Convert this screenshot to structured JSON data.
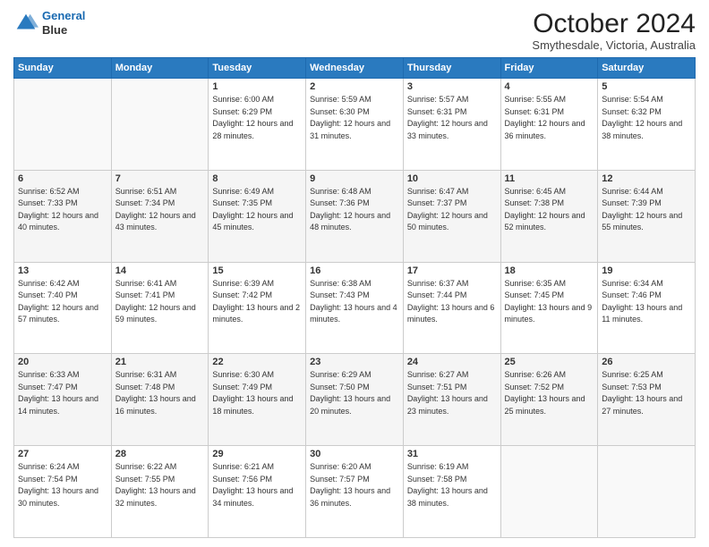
{
  "logo": {
    "line1": "General",
    "line2": "Blue"
  },
  "title": "October 2024",
  "subtitle": "Smythesdale, Victoria, Australia",
  "days_of_week": [
    "Sunday",
    "Monday",
    "Tuesday",
    "Wednesday",
    "Thursday",
    "Friday",
    "Saturday"
  ],
  "weeks": [
    [
      {
        "day": "",
        "sunrise": "",
        "sunset": "",
        "daylight": ""
      },
      {
        "day": "",
        "sunrise": "",
        "sunset": "",
        "daylight": ""
      },
      {
        "day": "1",
        "sunrise": "Sunrise: 6:00 AM",
        "sunset": "Sunset: 6:29 PM",
        "daylight": "Daylight: 12 hours and 28 minutes."
      },
      {
        "day": "2",
        "sunrise": "Sunrise: 5:59 AM",
        "sunset": "Sunset: 6:30 PM",
        "daylight": "Daylight: 12 hours and 31 minutes."
      },
      {
        "day": "3",
        "sunrise": "Sunrise: 5:57 AM",
        "sunset": "Sunset: 6:31 PM",
        "daylight": "Daylight: 12 hours and 33 minutes."
      },
      {
        "day": "4",
        "sunrise": "Sunrise: 5:55 AM",
        "sunset": "Sunset: 6:31 PM",
        "daylight": "Daylight: 12 hours and 36 minutes."
      },
      {
        "day": "5",
        "sunrise": "Sunrise: 5:54 AM",
        "sunset": "Sunset: 6:32 PM",
        "daylight": "Daylight: 12 hours and 38 minutes."
      }
    ],
    [
      {
        "day": "6",
        "sunrise": "Sunrise: 6:52 AM",
        "sunset": "Sunset: 7:33 PM",
        "daylight": "Daylight: 12 hours and 40 minutes."
      },
      {
        "day": "7",
        "sunrise": "Sunrise: 6:51 AM",
        "sunset": "Sunset: 7:34 PM",
        "daylight": "Daylight: 12 hours and 43 minutes."
      },
      {
        "day": "8",
        "sunrise": "Sunrise: 6:49 AM",
        "sunset": "Sunset: 7:35 PM",
        "daylight": "Daylight: 12 hours and 45 minutes."
      },
      {
        "day": "9",
        "sunrise": "Sunrise: 6:48 AM",
        "sunset": "Sunset: 7:36 PM",
        "daylight": "Daylight: 12 hours and 48 minutes."
      },
      {
        "day": "10",
        "sunrise": "Sunrise: 6:47 AM",
        "sunset": "Sunset: 7:37 PM",
        "daylight": "Daylight: 12 hours and 50 minutes."
      },
      {
        "day": "11",
        "sunrise": "Sunrise: 6:45 AM",
        "sunset": "Sunset: 7:38 PM",
        "daylight": "Daylight: 12 hours and 52 minutes."
      },
      {
        "day": "12",
        "sunrise": "Sunrise: 6:44 AM",
        "sunset": "Sunset: 7:39 PM",
        "daylight": "Daylight: 12 hours and 55 minutes."
      }
    ],
    [
      {
        "day": "13",
        "sunrise": "Sunrise: 6:42 AM",
        "sunset": "Sunset: 7:40 PM",
        "daylight": "Daylight: 12 hours and 57 minutes."
      },
      {
        "day": "14",
        "sunrise": "Sunrise: 6:41 AM",
        "sunset": "Sunset: 7:41 PM",
        "daylight": "Daylight: 12 hours and 59 minutes."
      },
      {
        "day": "15",
        "sunrise": "Sunrise: 6:39 AM",
        "sunset": "Sunset: 7:42 PM",
        "daylight": "Daylight: 13 hours and 2 minutes."
      },
      {
        "day": "16",
        "sunrise": "Sunrise: 6:38 AM",
        "sunset": "Sunset: 7:43 PM",
        "daylight": "Daylight: 13 hours and 4 minutes."
      },
      {
        "day": "17",
        "sunrise": "Sunrise: 6:37 AM",
        "sunset": "Sunset: 7:44 PM",
        "daylight": "Daylight: 13 hours and 6 minutes."
      },
      {
        "day": "18",
        "sunrise": "Sunrise: 6:35 AM",
        "sunset": "Sunset: 7:45 PM",
        "daylight": "Daylight: 13 hours and 9 minutes."
      },
      {
        "day": "19",
        "sunrise": "Sunrise: 6:34 AM",
        "sunset": "Sunset: 7:46 PM",
        "daylight": "Daylight: 13 hours and 11 minutes."
      }
    ],
    [
      {
        "day": "20",
        "sunrise": "Sunrise: 6:33 AM",
        "sunset": "Sunset: 7:47 PM",
        "daylight": "Daylight: 13 hours and 14 minutes."
      },
      {
        "day": "21",
        "sunrise": "Sunrise: 6:31 AM",
        "sunset": "Sunset: 7:48 PM",
        "daylight": "Daylight: 13 hours and 16 minutes."
      },
      {
        "day": "22",
        "sunrise": "Sunrise: 6:30 AM",
        "sunset": "Sunset: 7:49 PM",
        "daylight": "Daylight: 13 hours and 18 minutes."
      },
      {
        "day": "23",
        "sunrise": "Sunrise: 6:29 AM",
        "sunset": "Sunset: 7:50 PM",
        "daylight": "Daylight: 13 hours and 20 minutes."
      },
      {
        "day": "24",
        "sunrise": "Sunrise: 6:27 AM",
        "sunset": "Sunset: 7:51 PM",
        "daylight": "Daylight: 13 hours and 23 minutes."
      },
      {
        "day": "25",
        "sunrise": "Sunrise: 6:26 AM",
        "sunset": "Sunset: 7:52 PM",
        "daylight": "Daylight: 13 hours and 25 minutes."
      },
      {
        "day": "26",
        "sunrise": "Sunrise: 6:25 AM",
        "sunset": "Sunset: 7:53 PM",
        "daylight": "Daylight: 13 hours and 27 minutes."
      }
    ],
    [
      {
        "day": "27",
        "sunrise": "Sunrise: 6:24 AM",
        "sunset": "Sunset: 7:54 PM",
        "daylight": "Daylight: 13 hours and 30 minutes."
      },
      {
        "day": "28",
        "sunrise": "Sunrise: 6:22 AM",
        "sunset": "Sunset: 7:55 PM",
        "daylight": "Daylight: 13 hours and 32 minutes."
      },
      {
        "day": "29",
        "sunrise": "Sunrise: 6:21 AM",
        "sunset": "Sunset: 7:56 PM",
        "daylight": "Daylight: 13 hours and 34 minutes."
      },
      {
        "day": "30",
        "sunrise": "Sunrise: 6:20 AM",
        "sunset": "Sunset: 7:57 PM",
        "daylight": "Daylight: 13 hours and 36 minutes."
      },
      {
        "day": "31",
        "sunrise": "Sunrise: 6:19 AM",
        "sunset": "Sunset: 7:58 PM",
        "daylight": "Daylight: 13 hours and 38 minutes."
      },
      {
        "day": "",
        "sunrise": "",
        "sunset": "",
        "daylight": ""
      },
      {
        "day": "",
        "sunrise": "",
        "sunset": "",
        "daylight": ""
      }
    ]
  ]
}
